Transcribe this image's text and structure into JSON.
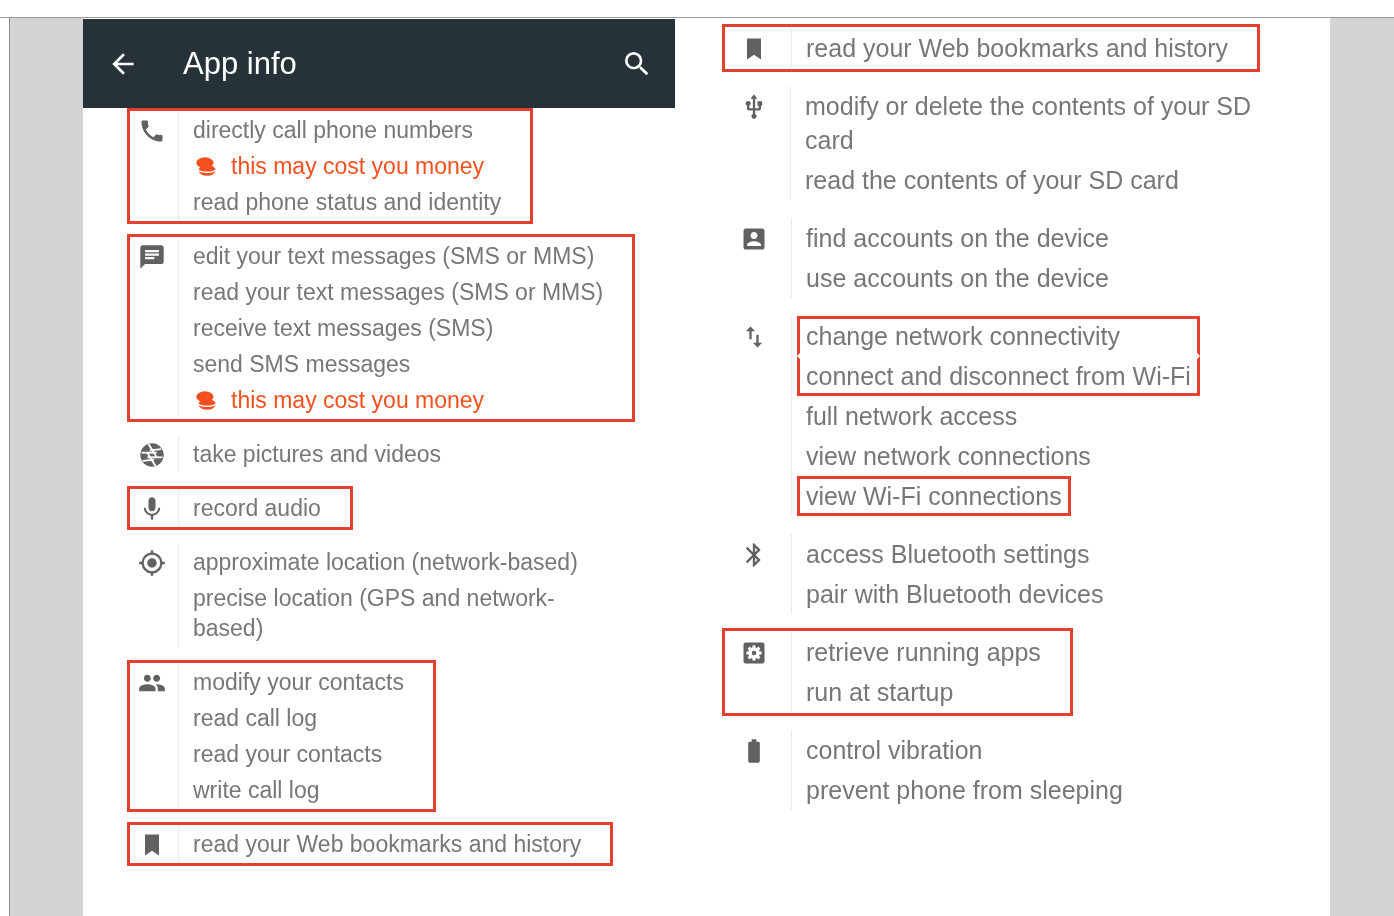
{
  "app_bar": {
    "title": "App info"
  },
  "columns": [
    {
      "groups": [
        {
          "kind": "phone",
          "highlighted": true,
          "lines": [
            {
              "kind": "permission",
              "text": "directly call phone numbers",
              "highlighted": false
            },
            {
              "kind": "warning",
              "text": "this may cost you money",
              "highlighted": false
            },
            {
              "kind": "permission",
              "text": "read phone status and identity",
              "highlighted": false
            }
          ]
        },
        {
          "kind": "message",
          "highlighted": true,
          "lines": [
            {
              "kind": "permission",
              "text": "edit your text messages (SMS or MMS)",
              "highlighted": false
            },
            {
              "kind": "permission",
              "text": "read your text messages (SMS or MMS)",
              "highlighted": false
            },
            {
              "kind": "permission",
              "text": "receive text messages (SMS)",
              "highlighted": false
            },
            {
              "kind": "permission",
              "text": "send SMS messages",
              "highlighted": false
            },
            {
              "kind": "warning",
              "text": "this may cost you money",
              "highlighted": false
            }
          ]
        },
        {
          "kind": "camera",
          "highlighted": false,
          "lines": [
            {
              "kind": "permission",
              "text": "take pictures and videos",
              "highlighted": false
            }
          ]
        },
        {
          "kind": "microphone",
          "highlighted": true,
          "lines": [
            {
              "kind": "permission",
              "text": "record audio",
              "highlighted": false
            }
          ]
        },
        {
          "kind": "location",
          "highlighted": false,
          "lines": [
            {
              "kind": "permission",
              "text": "approximate location (network-based)",
              "highlighted": false
            },
            {
              "kind": "permission",
              "text": "precise location (GPS and network-based)",
              "highlighted": false
            }
          ]
        },
        {
          "kind": "people",
          "highlighted": true,
          "lines": [
            {
              "kind": "permission",
              "text": "modify your contacts",
              "highlighted": false
            },
            {
              "kind": "permission",
              "text": "read call log",
              "highlighted": false
            },
            {
              "kind": "permission",
              "text": "read your contacts",
              "highlighted": false
            },
            {
              "kind": "permission",
              "text": "write call log",
              "highlighted": false
            }
          ]
        },
        {
          "kind": "bookmark",
          "highlighted": true,
          "lines": [
            {
              "kind": "permission",
              "text": "read your Web bookmarks and history",
              "highlighted": false
            }
          ]
        }
      ]
    },
    {
      "groups": [
        {
          "kind": "bookmark",
          "highlighted": true,
          "lines": [
            {
              "kind": "permission",
              "text": "read your Web bookmarks and history",
              "highlighted": false
            }
          ]
        },
        {
          "kind": "usb",
          "highlighted": false,
          "lines": [
            {
              "kind": "permission",
              "text": "modify or delete the contents of your SD card",
              "highlighted": false
            },
            {
              "kind": "permission",
              "text": "read the contents of your SD card",
              "highlighted": false
            }
          ]
        },
        {
          "kind": "account",
          "highlighted": false,
          "lines": [
            {
              "kind": "permission",
              "text": "find accounts on the device",
              "highlighted": false
            },
            {
              "kind": "permission",
              "text": "use accounts on the device",
              "highlighted": false
            }
          ]
        },
        {
          "kind": "network",
          "highlighted": false,
          "lines": [
            {
              "kind": "permission",
              "text": "change network connectivity",
              "highlighted": true
            },
            {
              "kind": "permission",
              "text": "connect and disconnect from Wi-Fi",
              "highlighted": true
            },
            {
              "kind": "permission",
              "text": "full network access",
              "highlighted": false
            },
            {
              "kind": "permission",
              "text": "view network connections",
              "highlighted": false
            },
            {
              "kind": "permission",
              "text": "view Wi-Fi connections",
              "highlighted": true
            }
          ]
        },
        {
          "kind": "bluetooth",
          "highlighted": false,
          "lines": [
            {
              "kind": "permission",
              "text": "access Bluetooth settings",
              "highlighted": false
            },
            {
              "kind": "permission",
              "text": "pair with Bluetooth devices",
              "highlighted": false
            }
          ]
        },
        {
          "kind": "settings",
          "highlighted": true,
          "lines": [
            {
              "kind": "permission",
              "text": "retrieve running apps",
              "highlighted": false
            },
            {
              "kind": "permission",
              "text": "run at startup",
              "highlighted": false
            }
          ]
        },
        {
          "kind": "battery",
          "highlighted": false,
          "lines": [
            {
              "kind": "permission",
              "text": "control vibration",
              "highlighted": false
            },
            {
              "kind": "permission",
              "text": "prevent phone from sleeping",
              "highlighted": false
            }
          ]
        }
      ]
    }
  ]
}
